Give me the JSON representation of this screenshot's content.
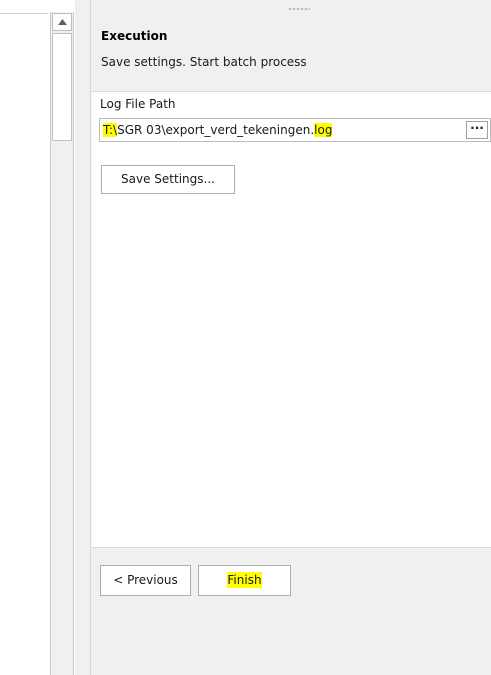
{
  "wizard": {
    "step_title": "Execution",
    "step_description": "Save settings. Start batch process"
  },
  "log_file": {
    "label": "Log File Path",
    "path_drive": "T:\\",
    "path_middle": "SGR 03\\export_verd_tekeningen.",
    "path_ext": "log",
    "browse_label": "···"
  },
  "buttons": {
    "save_settings": "Save Settings...",
    "previous": "< Previous",
    "finish": "Finish"
  },
  "colors": {
    "highlight": "#ffff00",
    "panel_background": "#f0f0f0"
  }
}
